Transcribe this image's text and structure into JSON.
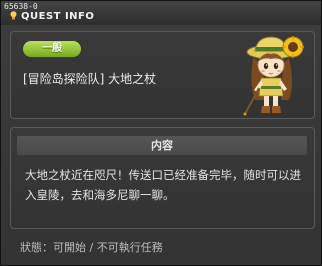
{
  "window": {
    "quest_id": "65638-0",
    "title": "QUEST INFO"
  },
  "quest": {
    "category": "一般",
    "name": "[冒险岛探险队] 大地之杖"
  },
  "content": {
    "header": "内容",
    "text": "大地之杖近在咫尺！传送口已经准备完毕，随时可以进入皇陵，去和海多尼聊一聊。"
  },
  "status": {
    "text": "狀態：可開始 / 不可執行任務"
  },
  "colors": {
    "badge_green": "#8cc02b",
    "background": "#3a3a3a",
    "panel_border": "#5b5b5b"
  },
  "icons": {
    "title": "lightbulb-icon",
    "npc": "npc-portrait"
  }
}
